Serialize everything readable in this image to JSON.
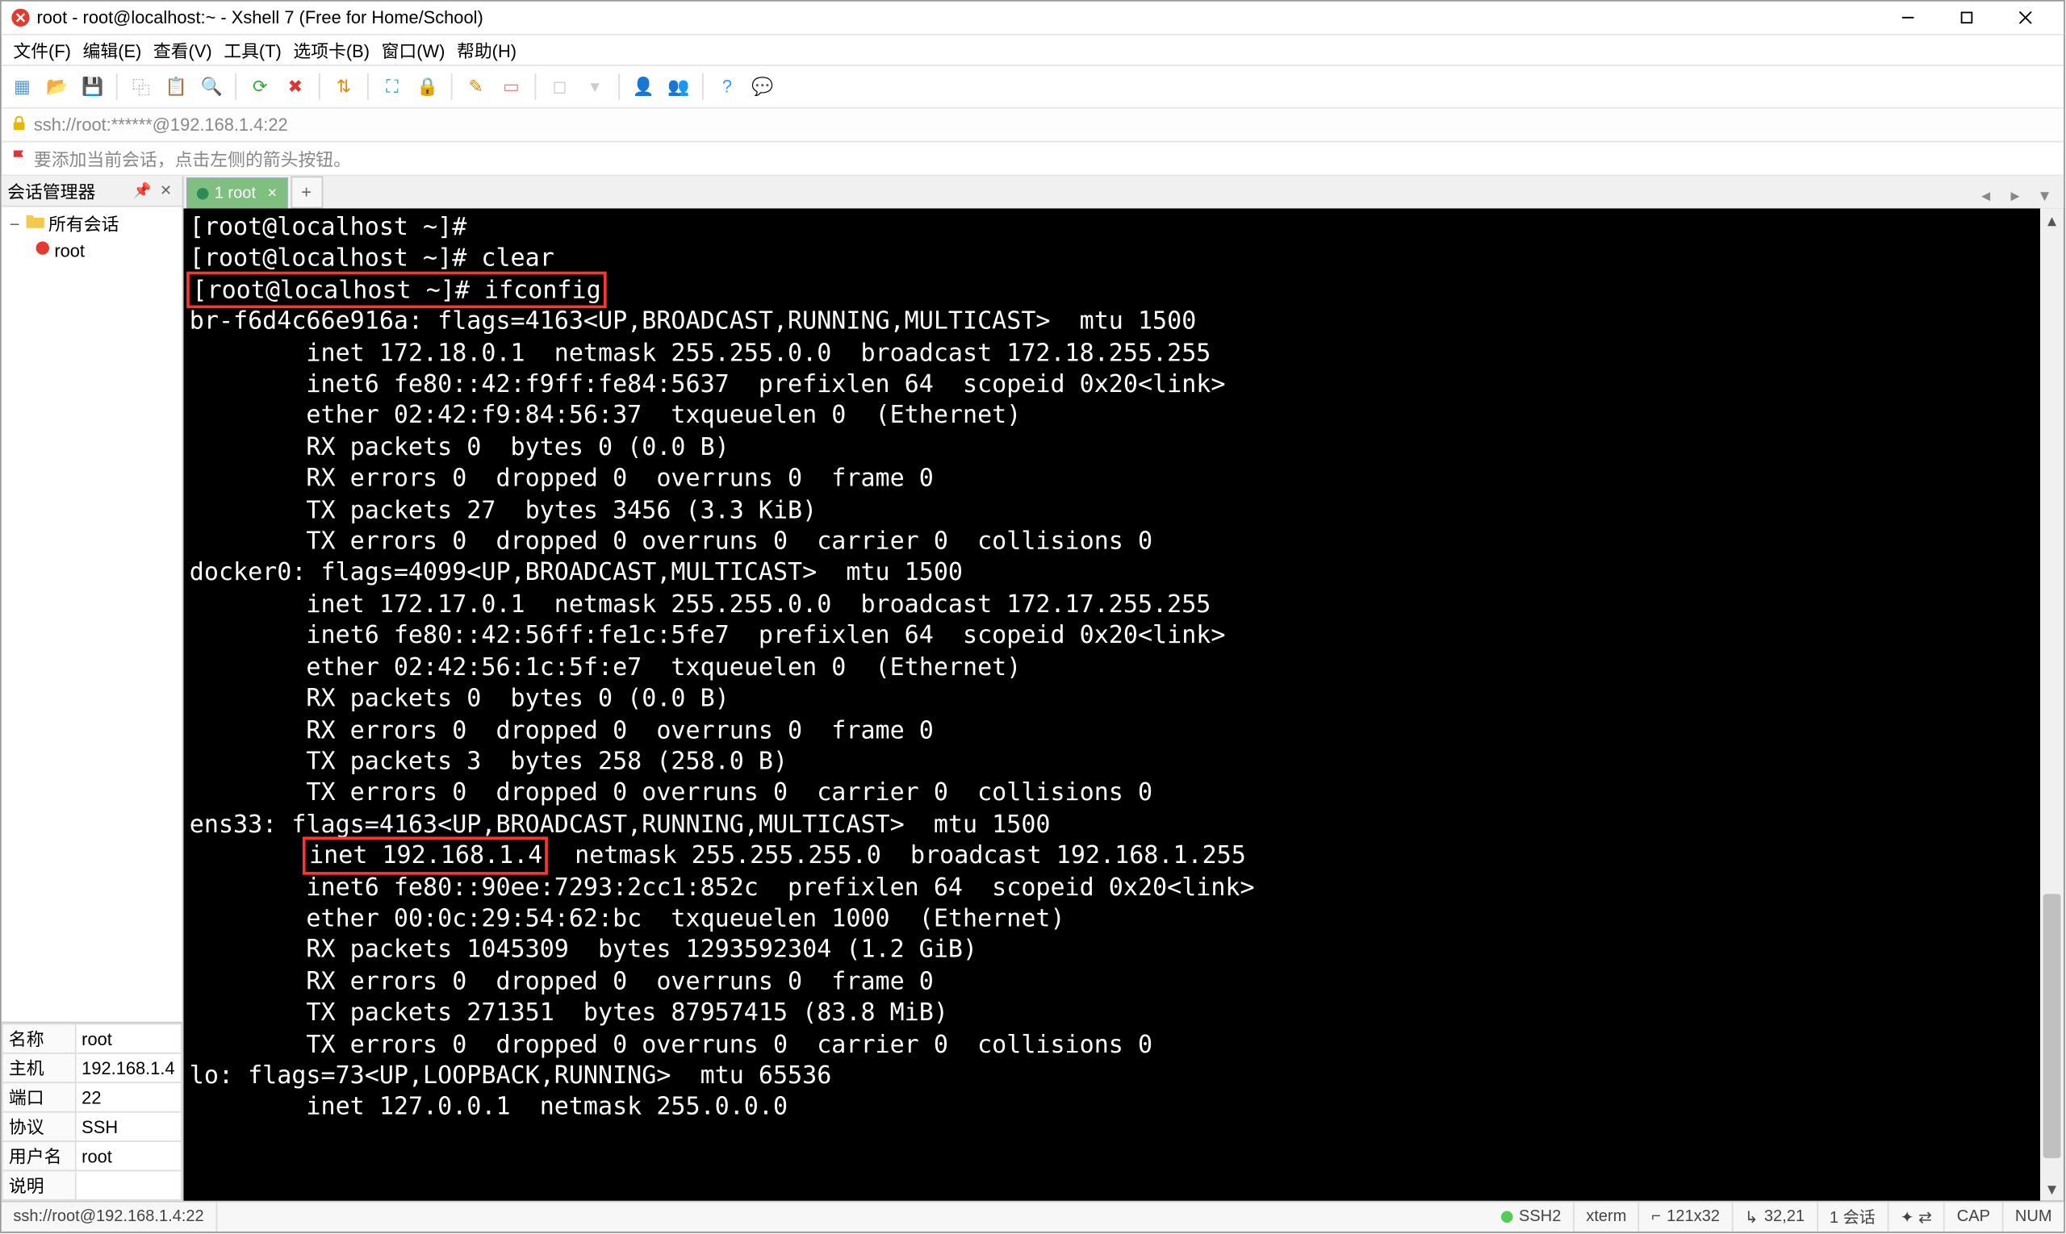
{
  "title": "root - root@localhost:~ - Xshell 7 (Free for Home/School)",
  "menus": [
    "文件(F)",
    "编辑(E)",
    "查看(V)",
    "工具(T)",
    "选项卡(B)",
    "窗口(W)",
    "帮助(H)"
  ],
  "address": "ssh://root:******@192.168.1.4:22",
  "hint": "要添加当前会话，点击左侧的箭头按钮。",
  "sidebar_title": "会话管理器",
  "tree": {
    "root_label": "所有会话",
    "session_label": "root"
  },
  "props": [
    {
      "k": "名称",
      "v": "root"
    },
    {
      "k": "主机",
      "v": "192.168.1.4"
    },
    {
      "k": "端口",
      "v": "22"
    },
    {
      "k": "协议",
      "v": "SSH"
    },
    {
      "k": "用户名",
      "v": "root"
    },
    {
      "k": "说明",
      "v": ""
    }
  ],
  "tab_label": "1 root",
  "terminal_lines": [
    {
      "t": "[root@localhost ~]#"
    },
    {
      "t": "[root@localhost ~]# clear"
    },
    {
      "t": "[root@localhost ~]# ifconfig",
      "hl": true
    },
    {
      "t": "br-f6d4c66e916a: flags=4163<UP,BROADCAST,RUNNING,MULTICAST>  mtu 1500"
    },
    {
      "t": "        inet 172.18.0.1  netmask 255.255.0.0  broadcast 172.18.255.255"
    },
    {
      "t": "        inet6 fe80::42:f9ff:fe84:5637  prefixlen 64  scopeid 0x20<link>"
    },
    {
      "t": "        ether 02:42:f9:84:56:37  txqueuelen 0  (Ethernet)"
    },
    {
      "t": "        RX packets 0  bytes 0 (0.0 B)"
    },
    {
      "t": "        RX errors 0  dropped 0  overruns 0  frame 0"
    },
    {
      "t": "        TX packets 27  bytes 3456 (3.3 KiB)"
    },
    {
      "t": "        TX errors 0  dropped 0 overruns 0  carrier 0  collisions 0"
    },
    {
      "t": ""
    },
    {
      "t": "docker0: flags=4099<UP,BROADCAST,MULTICAST>  mtu 1500"
    },
    {
      "t": "        inet 172.17.0.1  netmask 255.255.0.0  broadcast 172.17.255.255"
    },
    {
      "t": "        inet6 fe80::42:56ff:fe1c:5fe7  prefixlen 64  scopeid 0x20<link>"
    },
    {
      "t": "        ether 02:42:56:1c:5f:e7  txqueuelen 0  (Ethernet)"
    },
    {
      "t": "        RX packets 0  bytes 0 (0.0 B)"
    },
    {
      "t": "        RX errors 0  dropped 0  overruns 0  frame 0"
    },
    {
      "t": "        TX packets 3  bytes 258 (258.0 B)"
    },
    {
      "t": "        TX errors 0  dropped 0 overruns 0  carrier 0  collisions 0"
    },
    {
      "t": ""
    },
    {
      "t": "ens33: flags=4163<UP,BROADCAST,RUNNING,MULTICAST>  mtu 1500"
    },
    {
      "pre": "        ",
      "hl_part": "inet 192.168.1.4",
      "post": "  netmask 255.255.255.0  broadcast 192.168.1.255"
    },
    {
      "t": "        inet6 fe80::90ee:7293:2cc1:852c  prefixlen 64  scopeid 0x20<link>"
    },
    {
      "t": "        ether 00:0c:29:54:62:bc  txqueuelen 1000  (Ethernet)"
    },
    {
      "t": "        RX packets 1045309  bytes 1293592304 (1.2 GiB)"
    },
    {
      "t": "        RX errors 0  dropped 0  overruns 0  frame 0"
    },
    {
      "t": "        TX packets 271351  bytes 87957415 (83.8 MiB)"
    },
    {
      "t": "        TX errors 0  dropped 0 overruns 0  carrier 0  collisions 0"
    },
    {
      "t": ""
    },
    {
      "t": "lo: flags=73<UP,LOOPBACK,RUNNING>  mtu 65536"
    },
    {
      "t": "        inet 127.0.0.1  netmask 255.0.0.0"
    }
  ],
  "status": {
    "left": "ssh://root@192.168.1.4:22",
    "ssh": "SSH2",
    "term": "xterm",
    "size": "121x32",
    "pos": "32,21",
    "sess": "1 会话",
    "caps": "CAP",
    "num_": "NUM"
  },
  "toolbar_icons": [
    "new-session",
    "open",
    "save",
    "sep",
    "copy",
    "paste",
    "search",
    "sep",
    "reconnect",
    "disconnect",
    "sep",
    "new-file-transfer",
    "sep",
    "full-screen",
    "lock",
    "sep",
    "pencil",
    "eraser",
    "sep",
    "indicator1",
    "indicator2",
    "sep",
    "user1",
    "user2",
    "sep",
    "help",
    "chat"
  ]
}
